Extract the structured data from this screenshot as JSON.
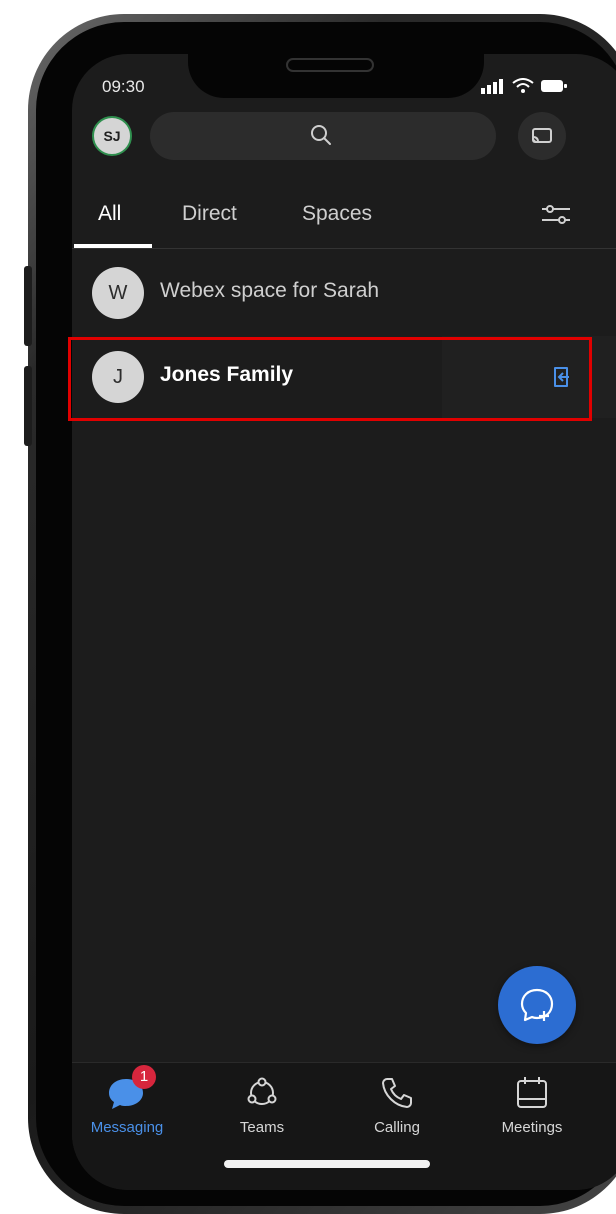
{
  "status_bar": {
    "time": "09:30"
  },
  "header": {
    "user_initials": "SJ",
    "search_icon": "search-icon",
    "cast_icon": "cast-icon"
  },
  "tabs": [
    {
      "label": "All",
      "active": true
    },
    {
      "label": "Direct",
      "active": false
    },
    {
      "label": "Spaces",
      "active": false
    }
  ],
  "filter_icon": "sliders-icon",
  "spaces": [
    {
      "initial": "W",
      "title": "Webex space for Sarah",
      "unread": false
    },
    {
      "initial": "J",
      "title": "Jones Family",
      "unread": true,
      "trailing_icon": "join-space-icon"
    }
  ],
  "fab_icon": "new-message-icon",
  "bottom_nav": [
    {
      "label": "Messaging",
      "icon": "message-bubble-icon",
      "badge": "1",
      "active": true
    },
    {
      "label": "Teams",
      "icon": "teams-icon",
      "active": false
    },
    {
      "label": "Calling",
      "icon": "phone-icon",
      "active": false
    },
    {
      "label": "Meetings",
      "icon": "calendar-icon",
      "active": false
    }
  ],
  "colors": {
    "accent": "#2c6dd2",
    "active_label": "#4a90e8",
    "badge": "#d7263d",
    "highlight_box": "#e10000",
    "background": "#1c1c1c"
  }
}
